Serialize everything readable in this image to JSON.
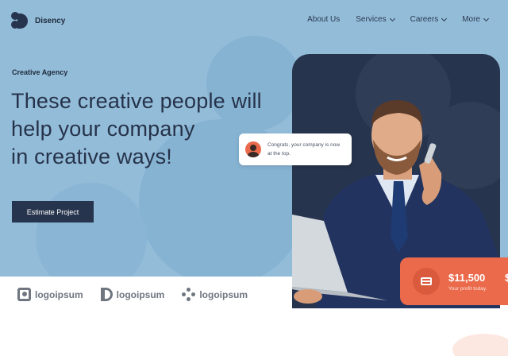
{
  "brand": {
    "name": "Disency"
  },
  "nav": {
    "items": [
      {
        "label": "About Us",
        "dropdown": false
      },
      {
        "label": "Services",
        "dropdown": true
      },
      {
        "label": "Careers",
        "dropdown": true
      },
      {
        "label": "More",
        "dropdown": true
      }
    ]
  },
  "hero": {
    "eyebrow": "Creative Agency",
    "headline_lines": [
      "These creative people will",
      "help your company",
      "in creative ways!"
    ],
    "cta_label": "Estimate Project"
  },
  "notification": {
    "text": "Congrats, your company is now at the top."
  },
  "profit": {
    "amount": "$11,500",
    "caption": "Your profit today.",
    "next_amount": "$"
  },
  "logos": [
    {
      "text": "logoipsum"
    },
    {
      "text": "logoipsum"
    },
    {
      "text": "logoipsum"
    }
  ],
  "colors": {
    "hero_bg": "#93bcd9",
    "navy": "#27344d",
    "accent": "#ea6a4b"
  }
}
